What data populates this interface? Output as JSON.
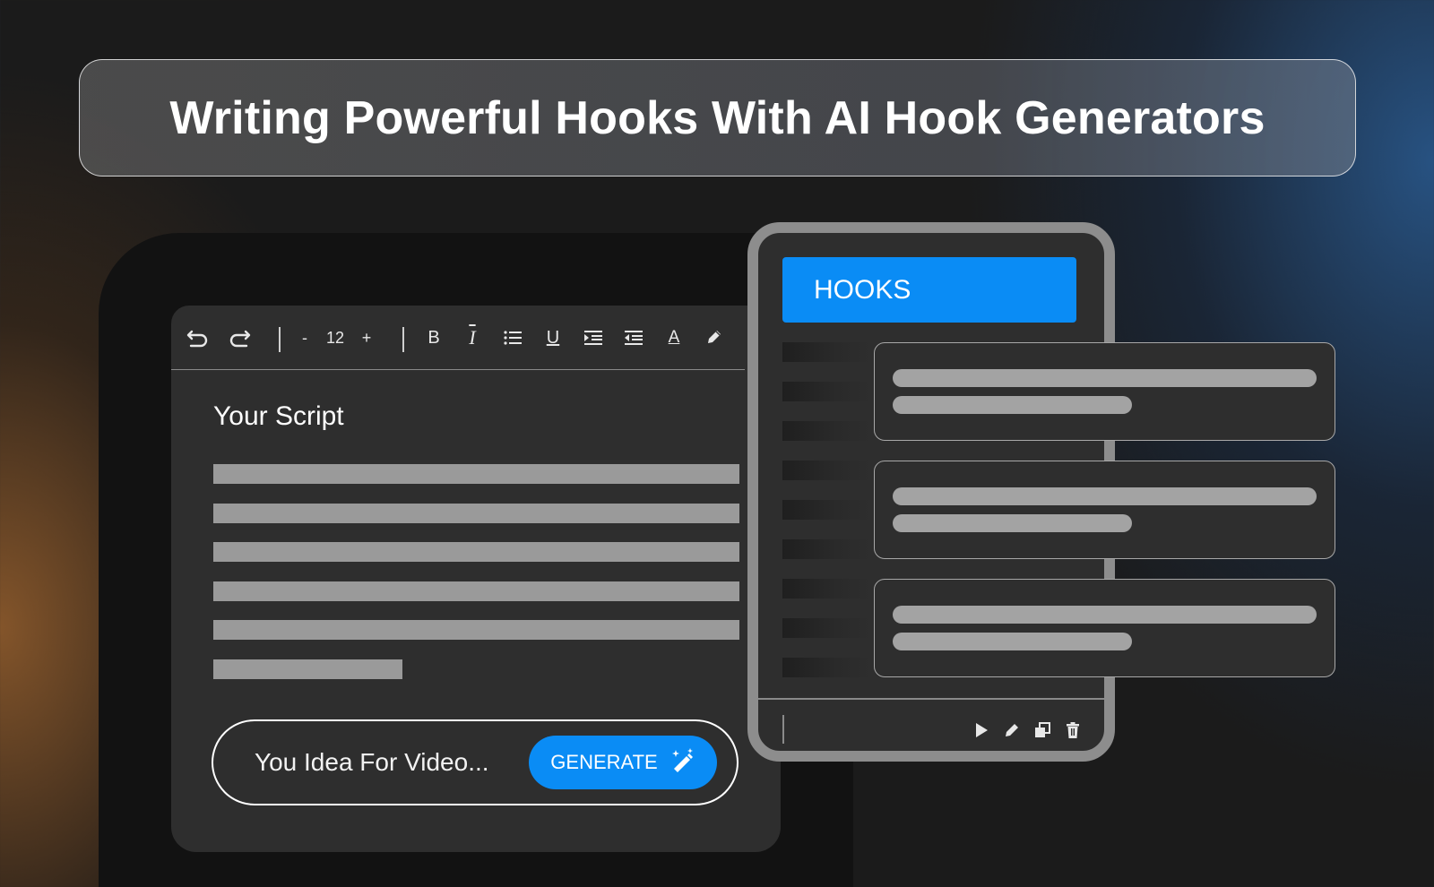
{
  "banner": {
    "title": "Writing Powerful Hooks With AI Hook Generators"
  },
  "editor": {
    "toolbar": {
      "undo_icon": "undo-icon",
      "redo_icon": "redo-icon",
      "decrease_label": "-",
      "font_size": "12",
      "increase_label": "+",
      "bold_label": "B",
      "italic_label": "I",
      "list_icon": "bulleted-list-icon",
      "underline_label": "U",
      "indent_icon": "indent-icon",
      "outdent_icon": "outdent-icon",
      "text_color_label": "A",
      "highlight_icon": "pen-icon"
    },
    "title": "Your Script",
    "placeholder_line_fractions": [
      1,
      1,
      1,
      1,
      1,
      0.36
    ],
    "prompt": {
      "input_text": "You Idea For Video...",
      "generate_label": "GENERATE",
      "generate_icon": "magic-wand-icon"
    }
  },
  "hooks": {
    "header": "HOOKS",
    "card_count": 3,
    "footer_icons": [
      "play-icon",
      "edit-icon",
      "copy-icon",
      "delete-icon"
    ]
  },
  "colors": {
    "accent": "#0a8cf5",
    "panel": "#2e2e2e",
    "placeholder": "#9a9a9a"
  }
}
